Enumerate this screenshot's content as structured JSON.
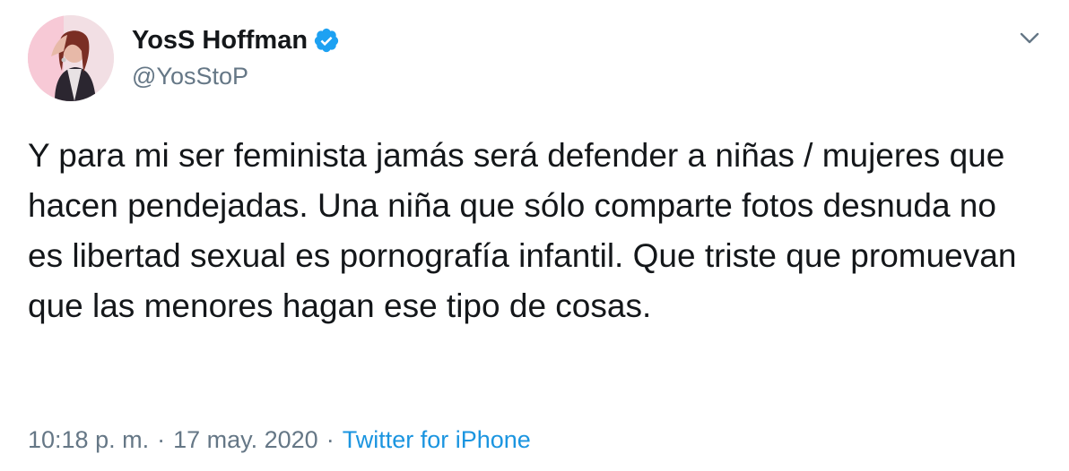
{
  "user": {
    "display_name": "YosS Hoffman",
    "handle": "@YosStoP",
    "verified": true,
    "avatar_icon": "profile-photo"
  },
  "menu": {
    "icon": "chevron-down-icon"
  },
  "tweet": {
    "text": "Y para mi ser feminista jamás será defender a niñas / mujeres que hacen pendejadas. Una niña que sólo comparte fotos desnuda no es libertad sexual es pornografía infantil. Que triste que promuevan que las menores hagan ese tipo de cosas."
  },
  "meta": {
    "time": "10:18 p. m.",
    "separator": "·",
    "date": "17 may. 2020",
    "source": "Twitter for iPhone"
  },
  "colors": {
    "text": "#14171a",
    "secondary": "#657786",
    "link": "#1b95e0",
    "verified": "#1da1f2"
  }
}
